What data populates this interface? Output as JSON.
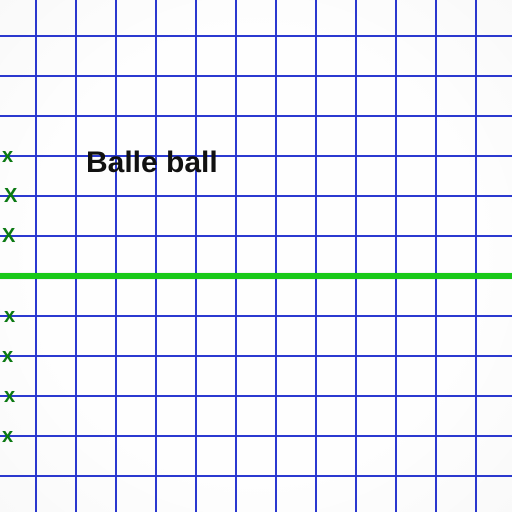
{
  "chart_data": {
    "type": "line",
    "title": "Balle ball",
    "xlabel": "",
    "ylabel": "",
    "x": [],
    "values": [],
    "axis_marks": [
      "x",
      "X",
      "X",
      "x",
      "x",
      "x",
      "x"
    ],
    "grid": {
      "rows": 13,
      "cols": 13,
      "cell": 40,
      "offset": -4,
      "color": "#2b39d1"
    },
    "axis_line_color": "#19c919",
    "axis_line_y_row": 7
  }
}
